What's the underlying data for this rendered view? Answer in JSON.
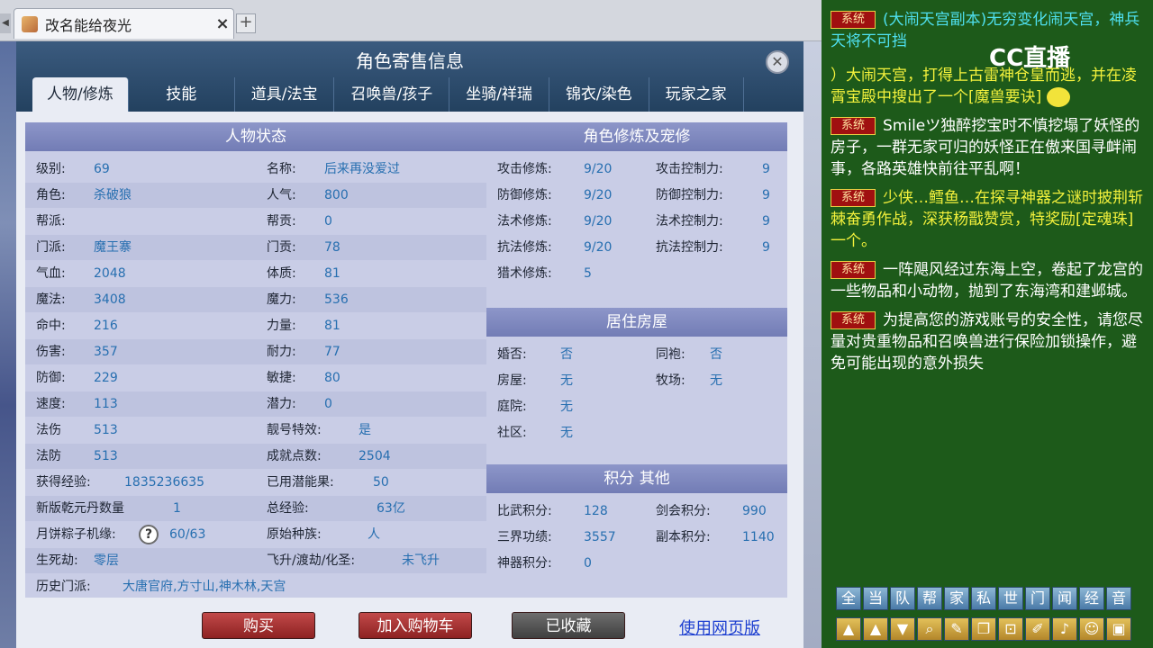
{
  "browser": {
    "tab_title": "改名能给夜光",
    "tab_close": "×",
    "new_tab": "+"
  },
  "dialog": {
    "title": "角色寄售信息",
    "close": "✕",
    "tabs": [
      "人物/修炼",
      "技能",
      "道具/法宝",
      "召唤兽/孩子",
      "坐骑/祥瑞",
      "锦衣/染色",
      "玩家之家"
    ],
    "status": {
      "header": "人物状态",
      "left": [
        {
          "label": "级别:",
          "value": "69"
        },
        {
          "label": "角色:",
          "value": "杀破狼"
        },
        {
          "label": "帮派:",
          "value": ""
        },
        {
          "label": "门派:",
          "value": "魔王寨"
        },
        {
          "label": "气血:",
          "value": "2048"
        },
        {
          "label": "魔法:",
          "value": "3408"
        },
        {
          "label": "命中:",
          "value": "216"
        },
        {
          "label": "伤害:",
          "value": "357"
        },
        {
          "label": "防御:",
          "value": "229"
        },
        {
          "label": "速度:",
          "value": "113"
        },
        {
          "label": "法伤",
          "value": "513"
        },
        {
          "label": "法防",
          "value": "513"
        },
        {
          "label": "获得经验:",
          "value": "1835236635"
        },
        {
          "label": "新版乾元丹数量",
          "value": "1"
        },
        {
          "label": "月饼粽子机缘:",
          "value": "60/63"
        },
        {
          "label": "生死劫:",
          "value": "零层"
        },
        {
          "label": "历史门派:",
          "value": "大唐官府,方寸山,神木林,天宫"
        }
      ],
      "right": [
        {
          "label": "名称:",
          "value": "后来再没爱过"
        },
        {
          "label": "人气:",
          "value": "800"
        },
        {
          "label": "帮贡:",
          "value": "0"
        },
        {
          "label": "门贡:",
          "value": "78"
        },
        {
          "label": "体质:",
          "value": "81"
        },
        {
          "label": "魔力:",
          "value": "536"
        },
        {
          "label": "力量:",
          "value": "81"
        },
        {
          "label": "耐力:",
          "value": "77"
        },
        {
          "label": "敏捷:",
          "value": "80"
        },
        {
          "label": "潜力:",
          "value": "0"
        },
        {
          "label": "靓号特效:",
          "value": "是"
        },
        {
          "label": "成就点数:",
          "value": "2504"
        },
        {
          "label": "已用潜能果:",
          "value": "50"
        },
        {
          "label": "总经验:",
          "value": "63亿"
        },
        {
          "label": "原始种族:",
          "value": "人"
        },
        {
          "label": "飞升/渡劫/化圣:",
          "value": "未飞升"
        }
      ],
      "help": "?"
    },
    "cultivation": {
      "header": "角色修炼及宠修",
      "left": [
        {
          "label": "攻击修炼:",
          "value": "9/20"
        },
        {
          "label": "防御修炼:",
          "value": "9/20"
        },
        {
          "label": "法术修炼:",
          "value": "9/20"
        },
        {
          "label": "抗法修炼:",
          "value": "9/20"
        },
        {
          "label": "猎术修炼:",
          "value": "5"
        }
      ],
      "right": [
        {
          "label": "攻击控制力:",
          "value": "9"
        },
        {
          "label": "防御控制力:",
          "value": "9"
        },
        {
          "label": "法术控制力:",
          "value": "9"
        },
        {
          "label": "抗法控制力:",
          "value": "9"
        }
      ]
    },
    "housing": {
      "header": "居住房屋",
      "left": [
        {
          "label": "婚否:",
          "value": "否"
        },
        {
          "label": "房屋:",
          "value": "无"
        },
        {
          "label": "庭院:",
          "value": "无"
        },
        {
          "label": "社区:",
          "value": "无"
        }
      ],
      "right": [
        {
          "label": "同袍:",
          "value": "否"
        },
        {
          "label": "牧场:",
          "value": "无"
        }
      ]
    },
    "points": {
      "header": "积分 其他",
      "left": [
        {
          "label": "比武积分:",
          "value": "128"
        },
        {
          "label": "三界功绩:",
          "value": "3557"
        },
        {
          "label": "神器积分:",
          "value": "0"
        }
      ],
      "right": [
        {
          "label": "剑会积分:",
          "value": "990"
        },
        {
          "label": "副本积分:",
          "value": "1140"
        }
      ]
    },
    "buttons": {
      "buy": "购买",
      "cart": "加入购物车",
      "saved": "已收藏",
      "web": "使用网页版"
    }
  },
  "chat": {
    "logo": "CC直播",
    "system_tag": "系统",
    "messages": [
      "(大闹天宫副本)无穷变化闹天宫，神兵天将不可挡",
      "）大闹天宫，打得上古雷神仓皇而逃，并在凌霄宝殿中搜出了一个[魔兽要诀]",
      "Smileツ独醉挖宝时不慎挖塌了妖怪的房子，一群无家可归的妖怪正在傲来国寻衅闹事，各路英雄快前往平乱啊！",
      "少侠…鳕鱼…在探寻神器之谜时披荆斩棘奋勇作战，深获杨戬赞赏，特奖励[定魂珠]一个。",
      "一阵飓风经过东海上空，卷起了龙宫的一些物品和小动物，抛到了东海湾和建邺城。",
      "为提高您的游戏账号的安全性，请您尽量对贵重物品和召唤兽进行保险加锁操作，避免可能出现的意外损失"
    ],
    "channel_buttons": [
      "全",
      "当",
      "队",
      "帮",
      "家",
      "私",
      "世",
      "门",
      "闻",
      "经",
      "音"
    ]
  }
}
